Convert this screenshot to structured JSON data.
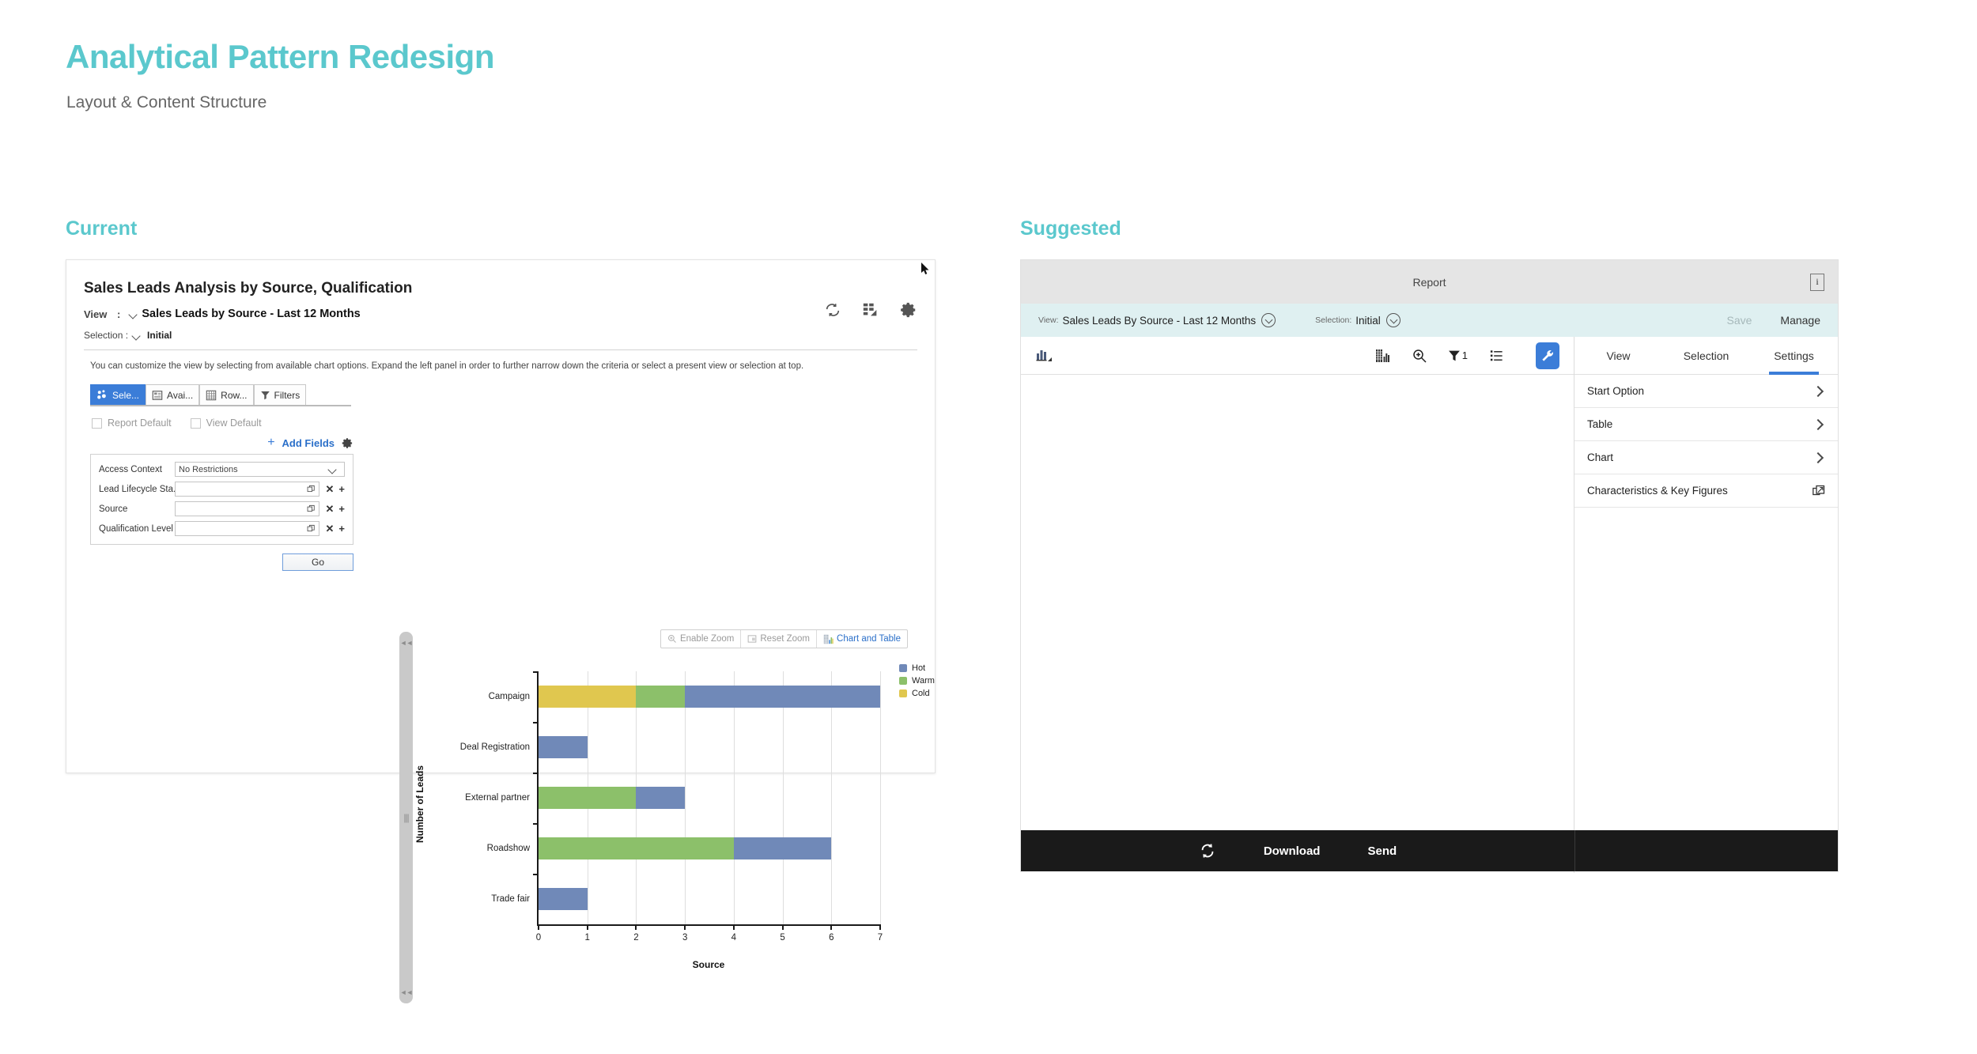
{
  "header": {
    "title": "Analytical Pattern Redesign",
    "subtitle": "Layout & Content Structure",
    "accent_color": "#5bc8cd"
  },
  "sections": {
    "current_label": "Current",
    "suggested_label": "Suggested"
  },
  "current": {
    "title": "Sales Leads Analysis by Source, Qualification",
    "view_label": "View",
    "view_colon": ":",
    "view_value": "Sales Leads by Source - Last 12 Months",
    "selection_label": "Selection :",
    "selection_value": "Initial",
    "help_text": "You can customize the view by selecting from available chart options. Expand the left panel in order to further narrow down the criteria or select a present view or selection at top.",
    "toolbar_icons": [
      "refresh-icon",
      "chart-table-toggle-icon",
      "settings-gear-icon"
    ],
    "tabs": [
      {
        "label": "Sele...",
        "icon": "selection-dots-icon",
        "active": true
      },
      {
        "label": "Avai...",
        "icon": "available-fields-icon",
        "active": false
      },
      {
        "label": "Row...",
        "icon": "rows-grid-icon",
        "active": false
      },
      {
        "label": "Filters",
        "icon": "filter-funnel-icon",
        "active": false
      }
    ],
    "checkboxes": [
      {
        "label": "Report Default",
        "checked": false
      },
      {
        "label": "View Default",
        "checked": false
      }
    ],
    "add_fields_label": "Add Fields",
    "add_plus": "+",
    "fields": [
      {
        "name": "Access Context",
        "value": "No Restrictions",
        "type": "select"
      },
      {
        "name": "Lead Lifecycle Sta..",
        "value": "",
        "type": "valuehelp"
      },
      {
        "name": "Source",
        "value": "",
        "type": "valuehelp"
      },
      {
        "name": "Qualification Level",
        "value": "",
        "type": "valuehelp"
      }
    ],
    "go_label": "Go",
    "chart_buttons": [
      {
        "label": "Enable Zoom",
        "icon": "zoom-in-icon",
        "enabled": false
      },
      {
        "label": "Reset Zoom",
        "icon": "reset-zoom-icon",
        "enabled": false
      },
      {
        "label": "Chart and Table",
        "icon": "chart-table-icon",
        "enabled": true
      }
    ]
  },
  "chart_data": {
    "type": "bar",
    "orientation": "horizontal",
    "stacked": true,
    "title": "",
    "xlabel": "Source",
    "ylabel": "Number of Leads",
    "categories": [
      "Campaign",
      "Deal Registration",
      "External partner",
      "Roadshow",
      "Trade fair"
    ],
    "series": [
      {
        "name": "Hot",
        "color": "#7089b8",
        "values": [
          4,
          1,
          1,
          2,
          1
        ]
      },
      {
        "name": "Warm",
        "color": "#8cc06a",
        "values": [
          1,
          0,
          2,
          4,
          0
        ]
      },
      {
        "name": "Cold",
        "color": "#e0c74f",
        "values": [
          2,
          0,
          0,
          0,
          0
        ]
      }
    ],
    "stack_order": [
      "Cold",
      "Warm",
      "Hot"
    ],
    "totals": [
      7,
      1,
      3,
      6,
      1
    ],
    "xlim": [
      0,
      7
    ],
    "xticks": [
      "0",
      "1",
      "2",
      "3",
      "4",
      "5",
      "6",
      "7"
    ],
    "grid": "vertical",
    "legend_position": "right",
    "legend": [
      "Hot",
      "Warm",
      "Cold"
    ]
  },
  "suggested": {
    "titlebar": {
      "title": "Report",
      "info_icon": "info-icon",
      "info_glyph": "i"
    },
    "viewbar": {
      "view_label": "View:",
      "view_value": "Sales Leads By Source - Last 12 Months",
      "selection_label": "Selection:",
      "selection_value": "Initial",
      "save_label": "Save",
      "manage_label": "Manage"
    },
    "toolbar": {
      "left_icon": "chart-type-icon",
      "right_icons": [
        {
          "name": "table-grid-icon"
        },
        {
          "name": "zoom-in-icon"
        },
        {
          "name": "filter-icon",
          "badge": "1"
        },
        {
          "name": "list-icon"
        }
      ],
      "wrench_icon": "wrench-icon"
    },
    "tabs": [
      {
        "label": "View",
        "active": false
      },
      {
        "label": "Selection",
        "active": false
      },
      {
        "label": "Settings",
        "active": true
      }
    ],
    "settings_items": [
      {
        "label": "Start Option",
        "icon": "chevron-right-icon"
      },
      {
        "label": "Table",
        "icon": "chevron-right-icon"
      },
      {
        "label": "Chart",
        "icon": "chevron-right-icon"
      },
      {
        "label": "Characteristics & Key Figures",
        "icon": "open-in-new-icon"
      }
    ],
    "footer": {
      "refresh_icon": "refresh-icon",
      "download_label": "Download",
      "send_label": "Send"
    }
  }
}
